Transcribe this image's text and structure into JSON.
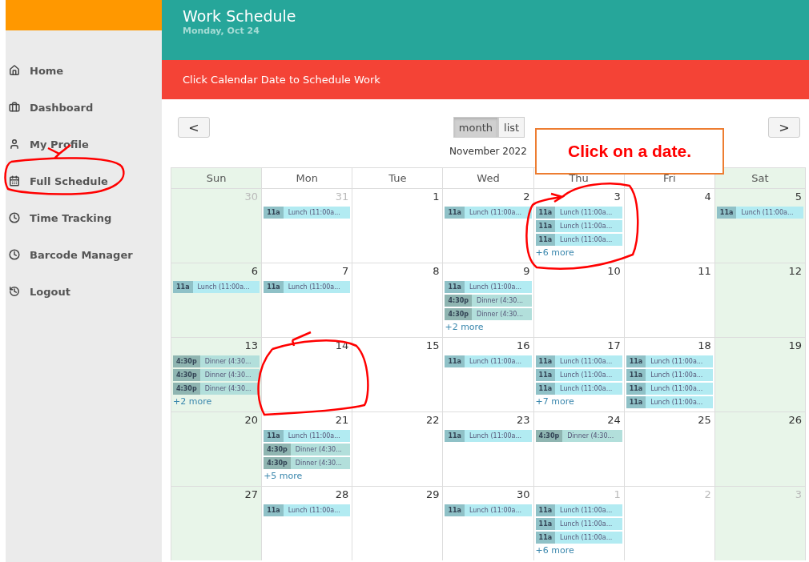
{
  "sidebar": {
    "items": [
      {
        "label": "Home"
      },
      {
        "label": "Dashboard"
      },
      {
        "label": "My Profile"
      },
      {
        "label": "Full Schedule"
      },
      {
        "label": "Time Tracking"
      },
      {
        "label": "Barcode Manager"
      },
      {
        "label": "Logout"
      }
    ]
  },
  "header": {
    "title": "Work Schedule",
    "subtitle": "Monday, Oct 24"
  },
  "alert": "Click Calendar Date to Schedule Work",
  "calendar": {
    "prev": "<",
    "next": ">",
    "views": [
      {
        "label": "month",
        "selected": true
      },
      {
        "label": "list",
        "selected": false
      }
    ],
    "title": "November 2022",
    "weekdays": [
      "Sun",
      "Mon",
      "Tue",
      "Wed",
      "Thu",
      "Fri",
      "Sat"
    ],
    "weeks": [
      [
        {
          "date": "30",
          "other_month": true
        },
        {
          "date": "31",
          "other_month": true,
          "events": [
            {
              "kind": "lunch",
              "time": "11a",
              "title": "Lunch (11:00a..."
            }
          ]
        },
        {
          "date": "1",
          "other_month": false
        },
        {
          "date": "2",
          "other_month": false,
          "events": [
            {
              "kind": "lunch",
              "time": "11a",
              "title": "Lunch (11:00a..."
            }
          ]
        },
        {
          "date": "3",
          "other_month": false,
          "events": [
            {
              "kind": "lunch",
              "time": "11a",
              "title": "Lunch (11:00a..."
            },
            {
              "kind": "lunch",
              "time": "11a",
              "title": "Lunch (11:00a..."
            },
            {
              "kind": "lunch",
              "time": "11a",
              "title": "Lunch (11:00a..."
            }
          ],
          "more": "+6 more"
        },
        {
          "date": "4",
          "other_month": false
        },
        {
          "date": "5",
          "other_month": false,
          "events": [
            {
              "kind": "lunch",
              "time": "11a",
              "title": "Lunch (11:00a..."
            }
          ]
        }
      ],
      [
        {
          "date": "6",
          "other_month": false,
          "events": [
            {
              "kind": "lunch",
              "time": "11a",
              "title": "Lunch (11:00a..."
            }
          ]
        },
        {
          "date": "7",
          "other_month": false,
          "events": [
            {
              "kind": "lunch",
              "time": "11a",
              "title": "Lunch (11:00a..."
            }
          ]
        },
        {
          "date": "8",
          "other_month": false
        },
        {
          "date": "9",
          "other_month": false,
          "events": [
            {
              "kind": "lunch",
              "time": "11a",
              "title": "Lunch (11:00a..."
            },
            {
              "kind": "dinner",
              "time": "4:30p",
              "title": "Dinner (4:30..."
            },
            {
              "kind": "dinner",
              "time": "4:30p",
              "title": "Dinner (4:30..."
            }
          ],
          "more": "+2 more"
        },
        {
          "date": "10",
          "other_month": false
        },
        {
          "date": "11",
          "other_month": false
        },
        {
          "date": "12",
          "other_month": false
        }
      ],
      [
        {
          "date": "13",
          "other_month": false,
          "events": [
            {
              "kind": "dinner",
              "time": "4:30p",
              "title": "Dinner (4:30..."
            },
            {
              "kind": "dinner",
              "time": "4:30p",
              "title": "Dinner (4:30..."
            },
            {
              "kind": "dinner",
              "time": "4:30p",
              "title": "Dinner (4:30..."
            }
          ],
          "more": "+2 more"
        },
        {
          "date": "14",
          "other_month": false
        },
        {
          "date": "15",
          "other_month": false
        },
        {
          "date": "16",
          "other_month": false,
          "events": [
            {
              "kind": "lunch",
              "time": "11a",
              "title": "Lunch (11:00a..."
            }
          ]
        },
        {
          "date": "17",
          "other_month": false,
          "events": [
            {
              "kind": "lunch",
              "time": "11a",
              "title": "Lunch (11:00a..."
            },
            {
              "kind": "lunch",
              "time": "11a",
              "title": "Lunch (11:00a..."
            },
            {
              "kind": "lunch",
              "time": "11a",
              "title": "Lunch (11:00a..."
            }
          ],
          "more": "+7 more"
        },
        {
          "date": "18",
          "other_month": false,
          "events": [
            {
              "kind": "lunch",
              "time": "11a",
              "title": "Lunch (11:00a..."
            },
            {
              "kind": "lunch",
              "time": "11a",
              "title": "Lunch (11:00a..."
            },
            {
              "kind": "lunch",
              "time": "11a",
              "title": "Lunch (11:00a..."
            },
            {
              "kind": "lunch",
              "time": "11a",
              "title": "Lunch (11:00a..."
            }
          ]
        },
        {
          "date": "19",
          "other_month": false
        }
      ],
      [
        {
          "date": "20",
          "other_month": false
        },
        {
          "date": "21",
          "other_month": false,
          "events": [
            {
              "kind": "lunch",
              "time": "11a",
              "title": "Lunch (11:00a..."
            },
            {
              "kind": "dinner",
              "time": "4:30p",
              "title": "Dinner (4:30..."
            },
            {
              "kind": "dinner",
              "time": "4:30p",
              "title": "Dinner (4:30..."
            }
          ],
          "more": "+5 more"
        },
        {
          "date": "22",
          "other_month": false
        },
        {
          "date": "23",
          "other_month": false,
          "events": [
            {
              "kind": "lunch",
              "time": "11a",
              "title": "Lunch (11:00a..."
            }
          ]
        },
        {
          "date": "24",
          "other_month": false,
          "events": [
            {
              "kind": "dinner",
              "time": "4:30p",
              "title": "Dinner (4:30..."
            }
          ]
        },
        {
          "date": "25",
          "other_month": false
        },
        {
          "date": "26",
          "other_month": false
        }
      ],
      [
        {
          "date": "27",
          "other_month": false
        },
        {
          "date": "28",
          "other_month": false,
          "events": [
            {
              "kind": "lunch",
              "time": "11a",
              "title": "Lunch (11:00a..."
            }
          ]
        },
        {
          "date": "29",
          "other_month": false
        },
        {
          "date": "30",
          "other_month": false,
          "events": [
            {
              "kind": "lunch",
              "time": "11a",
              "title": "Lunch (11:00a..."
            }
          ]
        },
        {
          "date": "1",
          "other_month": true,
          "events": [
            {
              "kind": "lunch",
              "time": "11a",
              "title": "Lunch (11:00a..."
            },
            {
              "kind": "lunch",
              "time": "11a",
              "title": "Lunch (11:00a..."
            },
            {
              "kind": "lunch",
              "time": "11a",
              "title": "Lunch (11:00a..."
            }
          ],
          "more": "+6 more"
        },
        {
          "date": "2",
          "other_month": true
        },
        {
          "date": "3",
          "other_month": true
        }
      ]
    ]
  },
  "callout": "Click on a date."
}
